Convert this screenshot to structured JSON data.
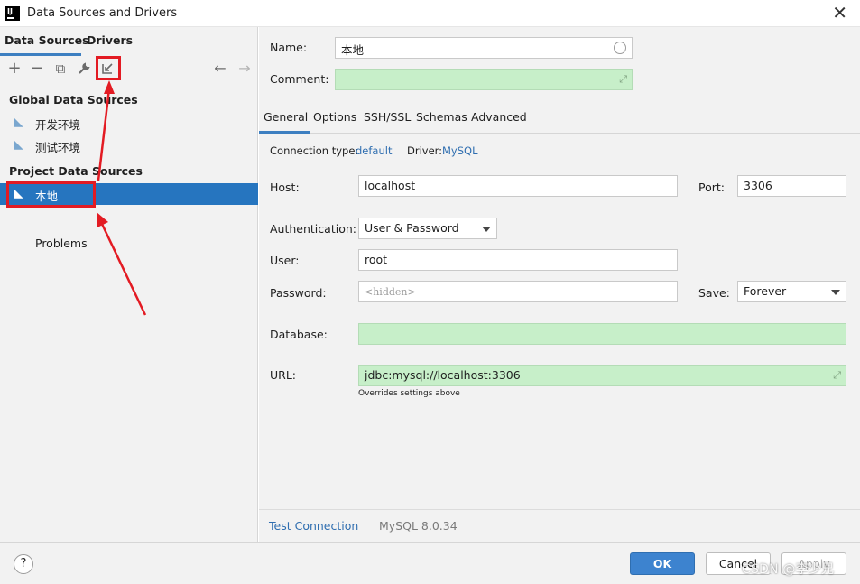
{
  "window": {
    "title": "Data Sources and Drivers",
    "app_icon_text": "IJ"
  },
  "left": {
    "tabs": [
      {
        "label": "Data Sources"
      },
      {
        "label": "Drivers"
      }
    ],
    "global_header": "Global Data Sources",
    "global_items": [
      {
        "label": "开发环境"
      },
      {
        "label": "测试环境"
      }
    ],
    "project_header": "Project Data Sources",
    "project_items": [
      {
        "label": "本地"
      }
    ],
    "problems": "Problems"
  },
  "right": {
    "name_label": "Name:",
    "name_value": "本地",
    "comment_label": "Comment:",
    "tabs": [
      {
        "label": "General"
      },
      {
        "label": "Options"
      },
      {
        "label": "SSH/SSL"
      },
      {
        "label": "Schemas"
      },
      {
        "label": "Advanced"
      }
    ],
    "connection_type_label": "Connection type:",
    "connection_type_value": "default",
    "driver_label": "Driver:",
    "driver_value": "MySQL",
    "host_label": "Host:",
    "host_value": "localhost",
    "port_label": "Port:",
    "port_value": "3306",
    "auth_label": "Authentication:",
    "auth_value": "User & Password",
    "user_label": "User:",
    "user_value": "root",
    "password_label": "Password:",
    "password_placeholder": "<hidden>",
    "save_label": "Save:",
    "save_value": "Forever",
    "database_label": "Database:",
    "url_label": "URL:",
    "url_value": "jdbc:mysql://localhost:3306",
    "url_hint": "Overrides settings above",
    "test_connection": "Test Connection",
    "version": "MySQL 8.0.34"
  },
  "buttons": {
    "help": "?",
    "ok": "OK",
    "cancel": "Cancel",
    "apply": "Apply"
  },
  "watermark": "CSDN @李少兄",
  "colors": {
    "accent": "#2675bf",
    "highlight": "#e31b23",
    "url_field": "#c7efc9"
  }
}
